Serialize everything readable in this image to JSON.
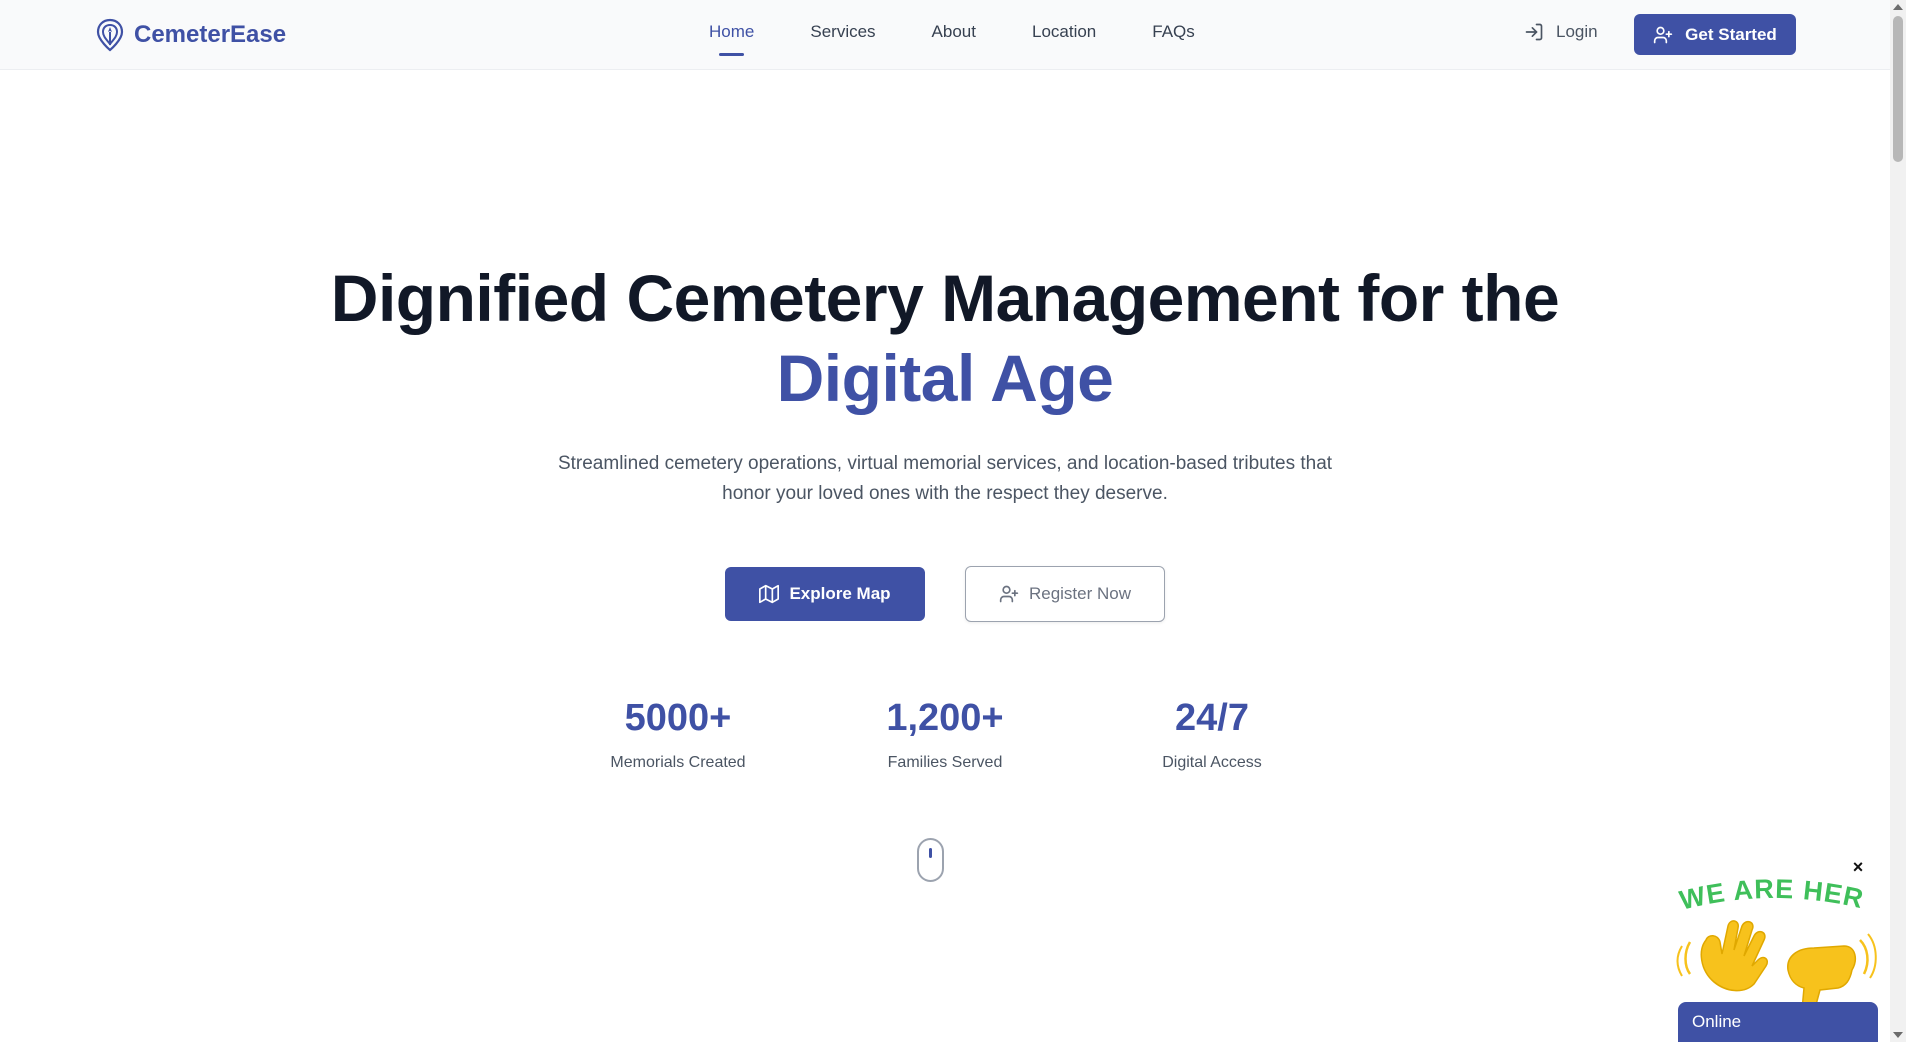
{
  "brand": {
    "name": "CemeterEase",
    "color": "#3f51a5",
    "icon": "location-pin-candle-icon"
  },
  "nav": {
    "items": [
      {
        "label": "Home",
        "active": true
      },
      {
        "label": "Services",
        "active": false
      },
      {
        "label": "About",
        "active": false
      },
      {
        "label": "Location",
        "active": false
      },
      {
        "label": "FAQs",
        "active": false
      }
    ]
  },
  "header_actions": {
    "login_label": "Login",
    "login_icon": "sign-in-icon",
    "get_started_label": "Get Started",
    "get_started_icon": "user-plus-icon"
  },
  "hero": {
    "title_line1": "Dignified Cemetery Management for the",
    "title_accent": "Digital Age",
    "subtitle": "Streamlined cemetery operations, virtual memorial services, and location-based tributes that honor your loved ones with the respect they deserve.",
    "primary_button": {
      "label": "Explore Map",
      "icon": "map-icon"
    },
    "secondary_button": {
      "label": "Register Now",
      "icon": "user-plus-icon"
    }
  },
  "stats": [
    {
      "value": "5000+",
      "label": "Memorials Created"
    },
    {
      "value": "1,200+",
      "label": "Families Served"
    },
    {
      "value": "24/7",
      "label": "Digital Access"
    }
  ],
  "chat_widget": {
    "banner_text": "WE ARE HERE!",
    "status_label": "Online",
    "close_label": "×"
  },
  "colors": {
    "accent": "#3f51a5",
    "heading": "#111827",
    "text": "#4b5563",
    "banner_green": "#3fbf5a",
    "hand_yellow": "#f7c21c"
  }
}
